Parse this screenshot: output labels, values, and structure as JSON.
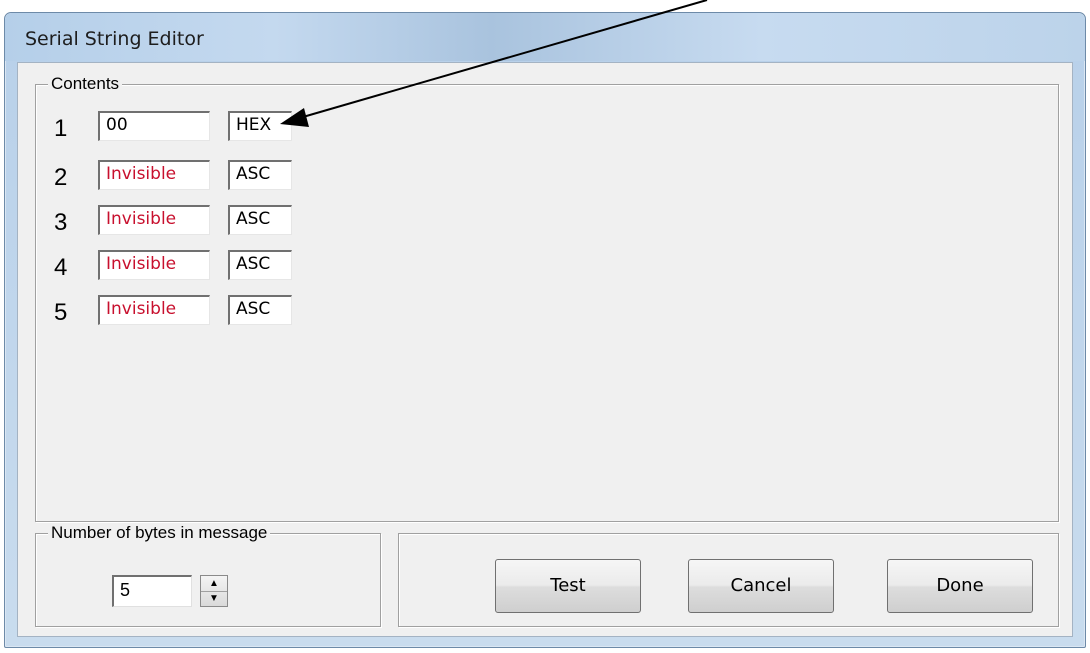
{
  "window": {
    "title": "Serial String Editor"
  },
  "contents": {
    "label": "Contents",
    "rows": [
      {
        "index": "1",
        "value": "00",
        "mode": "HEX",
        "value_color": "#000000"
      },
      {
        "index": "2",
        "value": "Invisible",
        "mode": "ASC",
        "value_color": "#c8102e"
      },
      {
        "index": "3",
        "value": "Invisible",
        "mode": "ASC",
        "value_color": "#c8102e"
      },
      {
        "index": "4",
        "value": "Invisible",
        "mode": "ASC",
        "value_color": "#c8102e"
      },
      {
        "index": "5",
        "value": "Invisible",
        "mode": "ASC",
        "value_color": "#c8102e"
      }
    ]
  },
  "bytes_group": {
    "label": "Number of bytes in message",
    "value": "5",
    "up_icon": "spin-up-icon",
    "down_icon": "spin-down-icon"
  },
  "buttons": {
    "test": "Test",
    "cancel": "Cancel",
    "done": "Done"
  },
  "annotation": {
    "icon": "pointer-arrow-icon",
    "color": "#000000"
  }
}
